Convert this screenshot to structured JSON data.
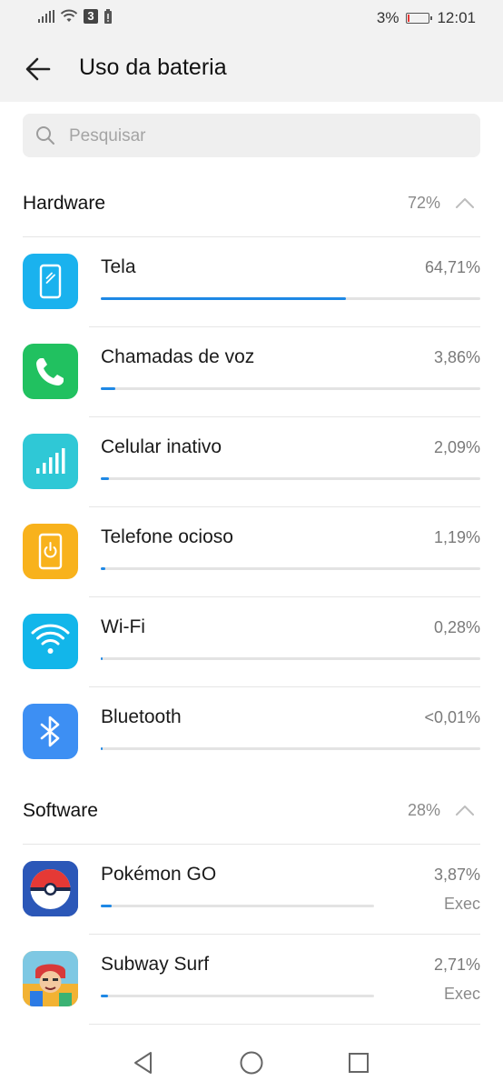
{
  "status_bar": {
    "carrier_badge": "3",
    "battery_percent": "3%",
    "battery_level": 0.03,
    "time": "12:01"
  },
  "header": {
    "title": "Uso da bateria",
    "back_icon": "arrow-left-icon"
  },
  "search": {
    "placeholder": "Pesquisar",
    "value": "",
    "icon": "search-icon"
  },
  "hardware": {
    "title": "Hardware",
    "percent": "72%",
    "items": [
      {
        "label": "Tela",
        "percent": "64,71%",
        "fraction": 0.6471,
        "icon": "display-icon",
        "color": "#1ab2ee"
      },
      {
        "label": "Chamadas de voz",
        "percent": "3,86%",
        "fraction": 0.0386,
        "icon": "phone-icon",
        "color": "#21c160"
      },
      {
        "label": "Celular inativo",
        "percent": "2,09%",
        "fraction": 0.0209,
        "icon": "signal-icon",
        "color": "#2fc8d6"
      },
      {
        "label": "Telefone ocioso",
        "percent": "1,19%",
        "fraction": 0.0119,
        "icon": "idle-phone-icon",
        "color": "#f8b21c"
      },
      {
        "label": "Wi-Fi",
        "percent": "0,28%",
        "fraction": 0.0028,
        "icon": "wifi-icon",
        "color": "#12b6ea"
      },
      {
        "label": "Bluetooth",
        "percent": "<0,01%",
        "fraction": 0.0001,
        "icon": "bluetooth-icon",
        "color": "#3d8ff3"
      }
    ]
  },
  "software": {
    "title": "Software",
    "percent": "28%",
    "items": [
      {
        "label": "Pokémon GO",
        "percent": "3,87%",
        "status": "Exec",
        "fraction": 0.0387,
        "icon": "pokeball-icon"
      },
      {
        "label": "Subway Surf",
        "percent": "2,71%",
        "status": "Exec",
        "fraction": 0.0271,
        "icon": "subway-surfers-icon"
      }
    ]
  },
  "nav_bar": {
    "back": "nav-back-icon",
    "home": "nav-home-icon",
    "recents": "nav-recents-icon"
  }
}
